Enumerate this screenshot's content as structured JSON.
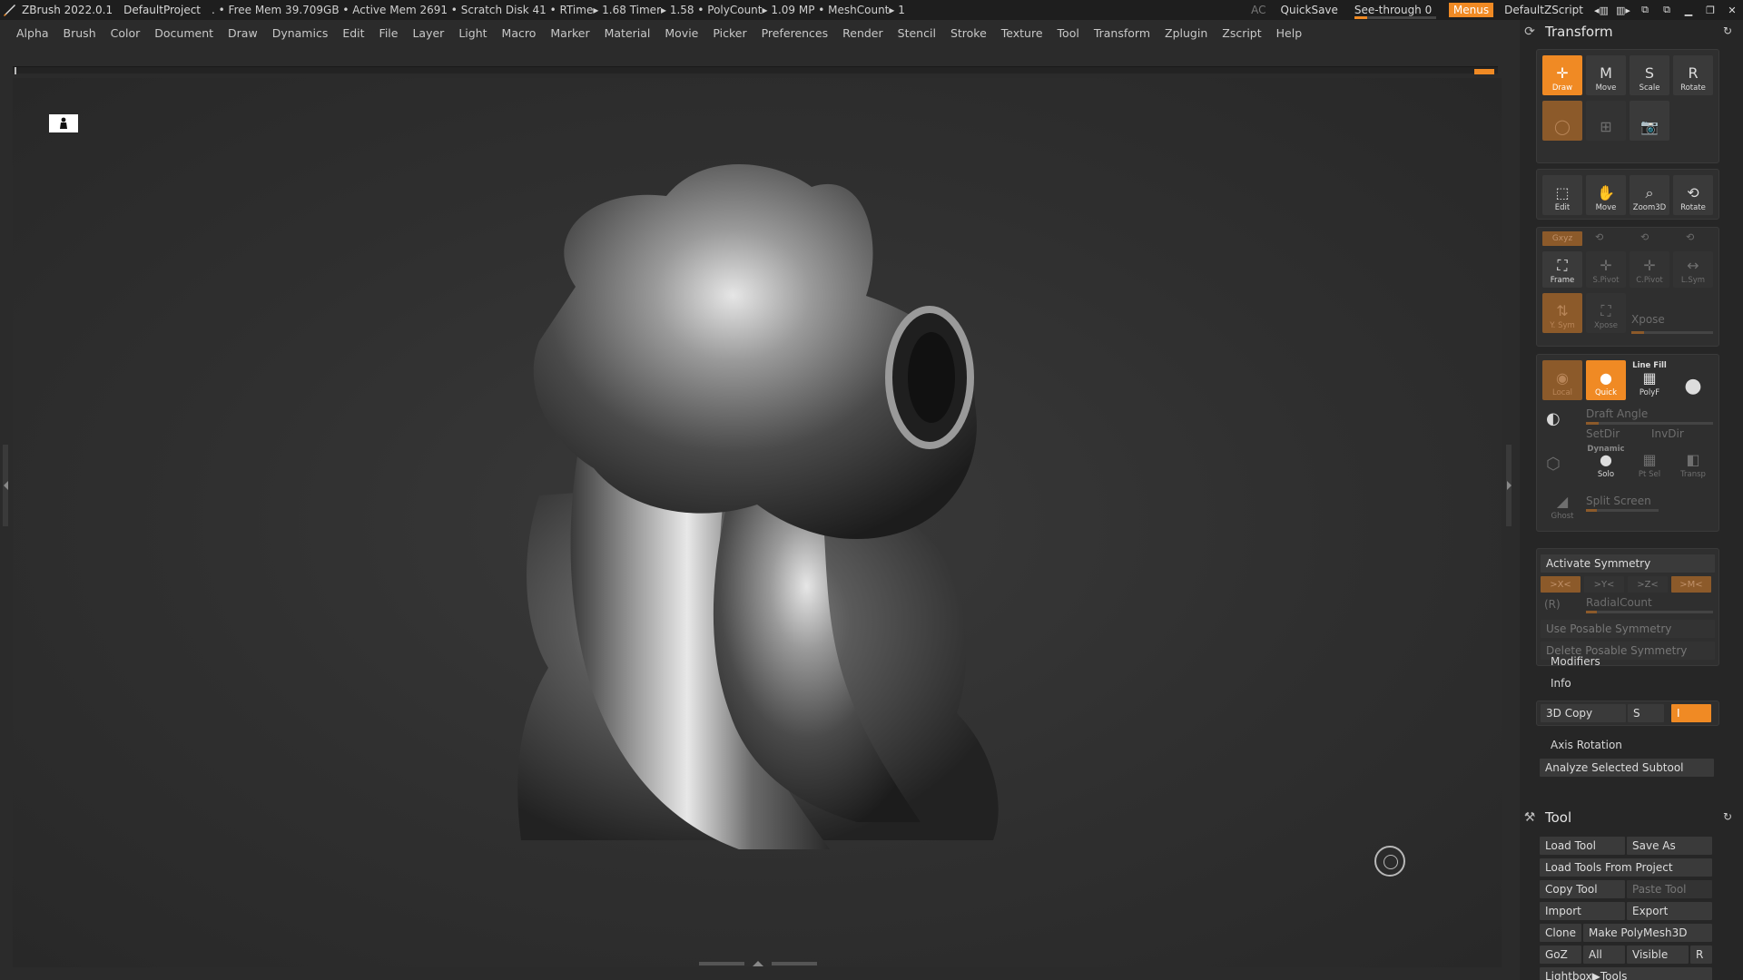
{
  "titlebar": {
    "app": "ZBrush 2022.0.1",
    "project": "DefaultProject",
    "stats": ". • Free Mem 39.709GB • Active Mem 2691 • Scratch Disk 41 • RTime▸ 1.68 Timer▸ 1.58 • PolyCount▸ 1.09 MP • MeshCount▸ 1",
    "ac": "AC",
    "quicksave": "QuickSave",
    "see_through": "See-through  0",
    "see_through_value": 0,
    "menus": "Menus",
    "script": "DefaultZScript"
  },
  "menubar": [
    "Alpha",
    "Brush",
    "Color",
    "Document",
    "Draw",
    "Dynamics",
    "Edit",
    "File",
    "Layer",
    "Light",
    "Macro",
    "Marker",
    "Material",
    "Movie",
    "Picker",
    "Preferences",
    "Render",
    "Stencil",
    "Stroke",
    "Texture",
    "Tool",
    "Transform",
    "Zplugin",
    "Zscript",
    "Help"
  ],
  "transform": {
    "title": "Transform",
    "row1": [
      "Draw",
      "Move",
      "Scale",
      "Rotate"
    ],
    "row3": [
      "Edit",
      "Move",
      "Zoom3D",
      "Rotate"
    ],
    "xyz": "Gxyz",
    "row5": [
      "Frame",
      "S.Pivot",
      "C.Pivot",
      "L.Sym"
    ],
    "vsym": "Y. Sym",
    "xpose_icon": "Xpose",
    "xpose": "Xpose",
    "row7": [
      "Local",
      "Quick",
      "PolyF"
    ],
    "line_fill": "Line Fill",
    "draft_angle": "Draft Angle",
    "setdir": "SetDir",
    "invdir": "InvDir",
    "dynamic": "Dynamic",
    "solo": "Solo",
    "ptsel": "Pt Sel",
    "transp": "Transp",
    "split_screen": "Split Screen",
    "ghost": "Ghost",
    "activate_symmetry": "Activate Symmetry",
    "sym_axes": [
      ">X<",
      ">Y<",
      ">Z<",
      ">M<"
    ],
    "r": "(R)",
    "radial_count": "RadialCount",
    "use_posable": "Use Posable Symmetry",
    "delete_posable": "Delete Posable Symmetry",
    "modifiers": "Modifiers",
    "info": "Info",
    "copy3d": "3D Copy",
    "s": "S",
    "i": "I",
    "axis_rotation": "Axis Rotation",
    "analyze": "Analyze Selected Subtool"
  },
  "tool": {
    "title": "Tool",
    "load_tool": "Load Tool",
    "save_as": "Save As",
    "load_from_project": "Load Tools From Project",
    "copy_tool": "Copy Tool",
    "paste_tool": "Paste Tool",
    "import": "Import",
    "export": "Export",
    "clone": "Clone",
    "make_polymesh": "Make PolyMesh3D",
    "goz": "GoZ",
    "all": "All",
    "visible": "Visible",
    "r": "R",
    "lightbox_tools": "Lightbox▶Tools"
  },
  "colors": {
    "accent": "#f08a24",
    "panel": "#262626",
    "canvas": "#2f2f2f"
  }
}
